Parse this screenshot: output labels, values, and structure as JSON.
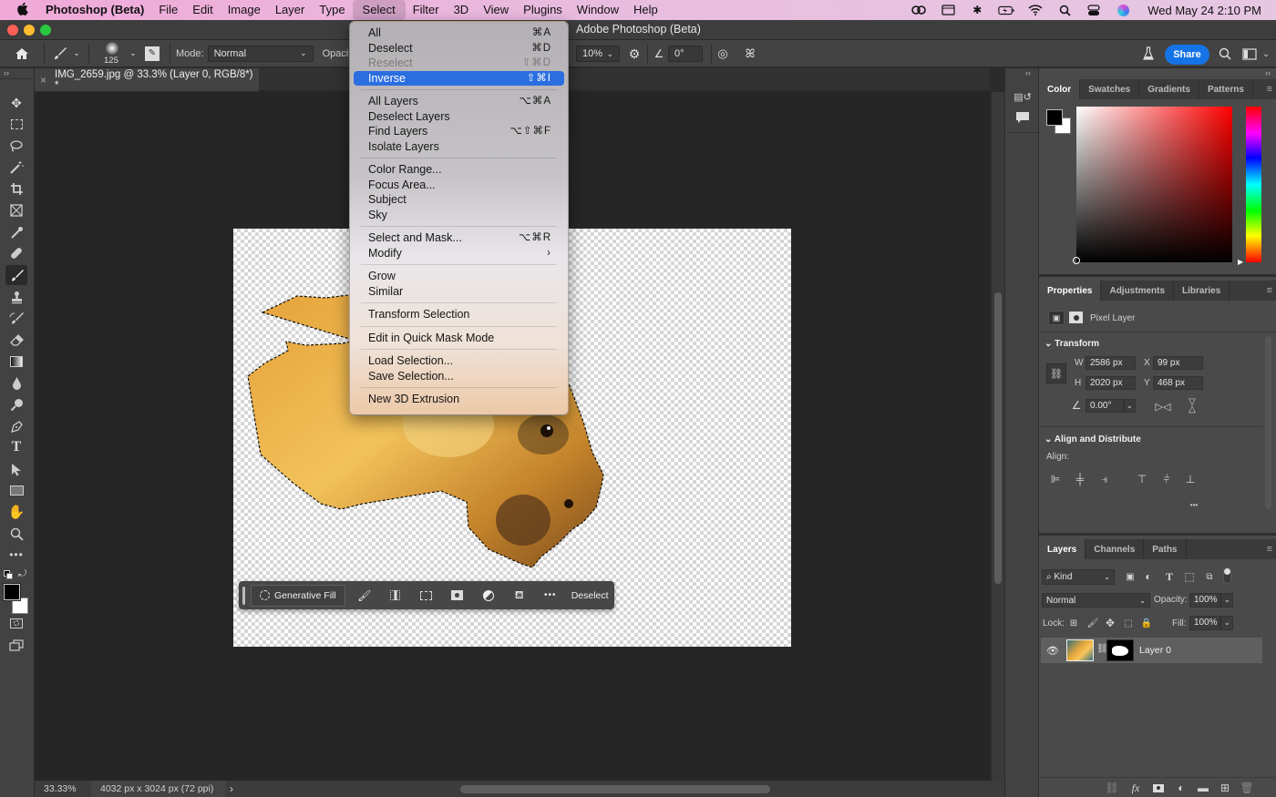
{
  "menubar": {
    "apple_icon": "",
    "app_name": "Photoshop (Beta)",
    "items": [
      "File",
      "Edit",
      "Image",
      "Layer",
      "Type",
      "Select",
      "Filter",
      "3D",
      "View",
      "Plugins",
      "Window",
      "Help"
    ],
    "active_item": "Select",
    "status_icons": [
      "creative-cloud-icon",
      "window-screen-icon",
      "bluetooth-icon",
      "battery-icon",
      "wifi-icon",
      "spotlight-search-icon",
      "control-center-icon",
      "siri-icon"
    ],
    "clock": "Wed May 24  2:10 PM"
  },
  "window": {
    "title": "Adobe Photoshop (Beta)",
    "traffic_colors": {
      "close": "#ff5f57",
      "minimize": "#febc2e",
      "zoom": "#28c840"
    }
  },
  "options_bar": {
    "brush_size": "125",
    "mode_label": "Mode:",
    "mode_value": "Normal",
    "opacity_label": "Opacity:",
    "smoothing_value": "10%",
    "angle_value": "0°",
    "share_label": "Share",
    "accent_color": "#1473e6"
  },
  "document": {
    "tab_title": "IMG_2659.jpg @ 33.3% (Layer 0, RGB/8*) *",
    "close_glyph": "×"
  },
  "status_bar": {
    "zoom": "33.33%",
    "dimensions": "4032 px x 3024 px (72 ppi)",
    "arrow": "›"
  },
  "select_menu": {
    "groups": [
      [
        {
          "label": "All",
          "shortcut": "⌘A"
        },
        {
          "label": "Deselect",
          "shortcut": "⌘D"
        },
        {
          "label": "Reselect",
          "shortcut": "⇧⌘D",
          "disabled": true
        },
        {
          "label": "Inverse",
          "shortcut": "⇧⌘I",
          "highlighted": true
        }
      ],
      [
        {
          "label": "All Layers",
          "shortcut": "⌥⌘A"
        },
        {
          "label": "Deselect Layers",
          "shortcut": ""
        },
        {
          "label": "Find Layers",
          "shortcut": "⌥⇧⌘F"
        },
        {
          "label": "Isolate Layers",
          "shortcut": ""
        }
      ],
      [
        {
          "label": "Color Range...",
          "shortcut": ""
        },
        {
          "label": "Focus Area...",
          "shortcut": ""
        },
        {
          "label": "Subject",
          "shortcut": ""
        },
        {
          "label": "Sky",
          "shortcut": ""
        }
      ],
      [
        {
          "label": "Select and Mask...",
          "shortcut": "⌥⌘R"
        },
        {
          "label": "Modify",
          "shortcut": "›"
        }
      ],
      [
        {
          "label": "Grow",
          "shortcut": ""
        },
        {
          "label": "Similar",
          "shortcut": ""
        }
      ],
      [
        {
          "label": "Transform Selection",
          "shortcut": ""
        }
      ],
      [
        {
          "label": "Edit in Quick Mask Mode",
          "shortcut": ""
        }
      ],
      [
        {
          "label": "Load Selection...",
          "shortcut": ""
        },
        {
          "label": "Save Selection...",
          "shortcut": ""
        }
      ],
      [
        {
          "label": "New 3D Extrusion",
          "shortcut": ""
        }
      ]
    ]
  },
  "contextual_taskbar": {
    "generative_fill_label": "Generative Fill",
    "deselect_label": "Deselect",
    "icons": [
      "modify-selection-brush-icon",
      "select-subject-icon",
      "transform-selection-icon",
      "create-mask-icon",
      "create-adjustment-icon",
      "fill-selection-icon",
      "more-options-icon"
    ]
  },
  "tools": [
    "move-tool-icon",
    "marquee-tool-icon",
    "lasso-tool-icon",
    "magic-wand-tool-icon",
    "crop-tool-icon",
    "frame-tool-icon",
    "eyedropper-tool-icon",
    "healing-brush-tool-icon",
    "brush-tool-icon",
    "clone-stamp-tool-icon",
    "history-brush-tool-icon",
    "eraser-tool-icon",
    "gradient-tool-icon",
    "blur-tool-icon",
    "dodge-tool-icon",
    "pen-tool-icon",
    "type-tool-icon",
    "path-selection-tool-icon",
    "rectangle-tool-icon",
    "hand-tool-icon",
    "zoom-tool-icon",
    "more-tools-icon"
  ],
  "selected_tool": "brush-tool-icon",
  "color_panel": {
    "tabs": [
      "Color",
      "Swatches",
      "Gradients",
      "Patterns"
    ],
    "active_tab": "Color",
    "foreground": "#000000",
    "background": "#ffffff",
    "hue_color": "#ff0000"
  },
  "properties_panel": {
    "tabs": [
      "Properties",
      "Adjustments",
      "Libraries"
    ],
    "active_tab": "Properties",
    "layer_kind": "Pixel Layer",
    "transform_title": "Transform",
    "w_label": "W",
    "w_value": "2586 px",
    "h_label": "H",
    "h_value": "2020 px",
    "x_label": "X",
    "x_value": "99 px",
    "y_label": "Y",
    "y_value": "468 px",
    "angle_value": "0.00°",
    "align_title": "Align and Distribute",
    "align_label": "Align:",
    "more": "•••"
  },
  "layers_panel": {
    "tabs": [
      "Layers",
      "Channels",
      "Paths"
    ],
    "active_tab": "Layers",
    "filter_kind": "Kind",
    "blend_mode": "Normal",
    "opacity_label": "Opacity:",
    "opacity_value": "100%",
    "lock_label": "Lock:",
    "fill_label": "Fill:",
    "fill_value": "100%",
    "layers": [
      {
        "name": "Layer 0",
        "visible": true,
        "selected": true,
        "has_mask": true
      }
    ]
  }
}
